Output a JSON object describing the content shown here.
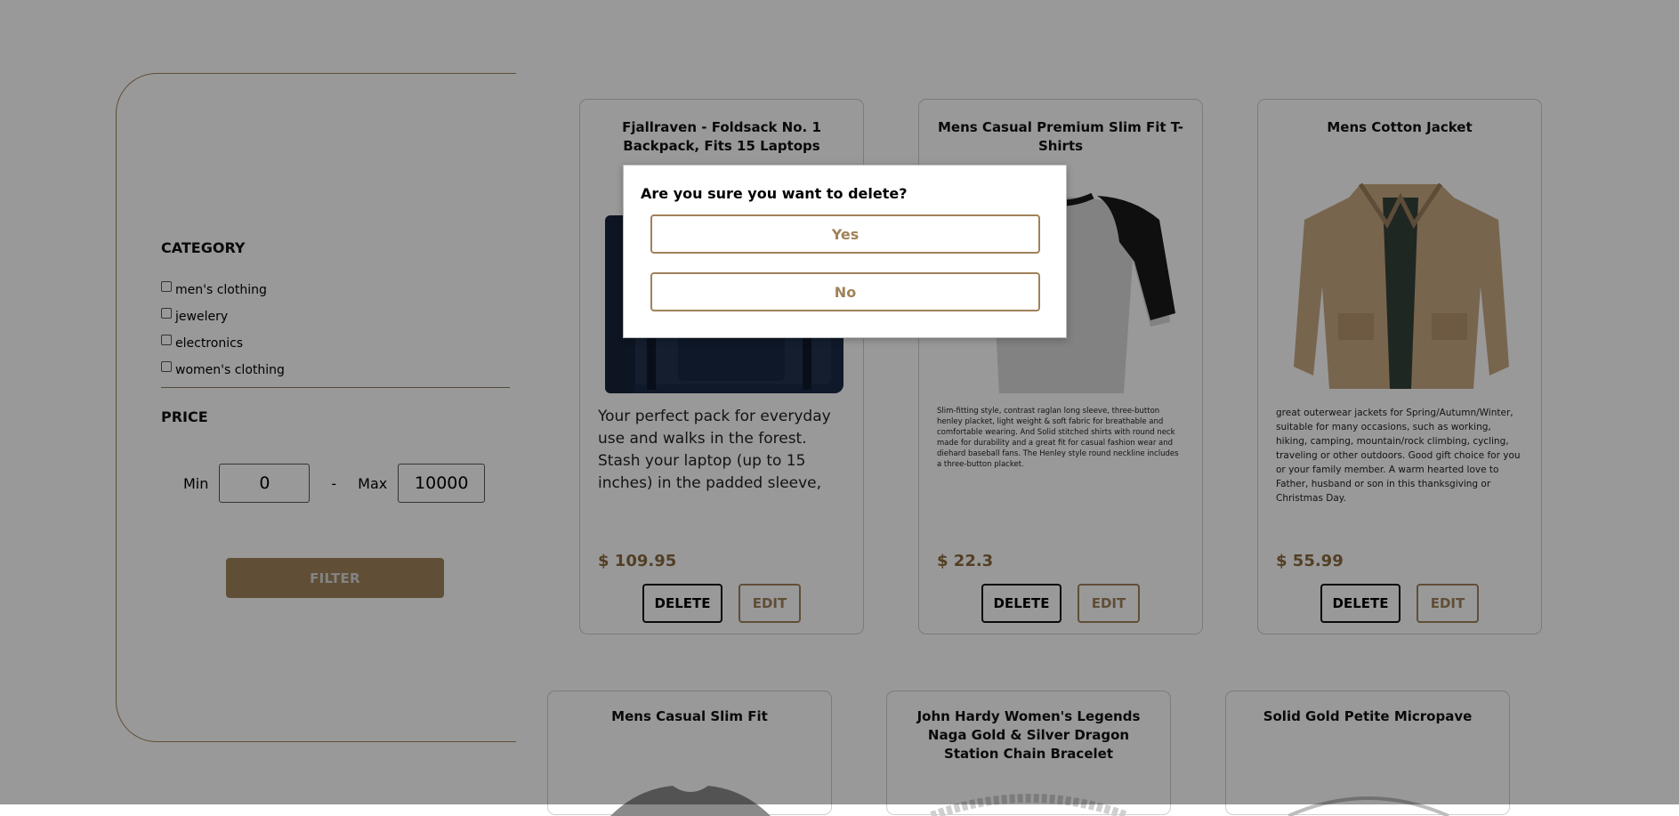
{
  "sidebar": {
    "category_heading": "CATEGORY",
    "categories": [
      "men's clothing",
      "jewelery",
      "electronics",
      "women's clothing"
    ],
    "price_heading": "PRICE",
    "min_label": "Min",
    "min_value": "0",
    "dash": "-",
    "max_label": "Max",
    "max_value": "10000",
    "filter_label": "FILTER"
  },
  "products": [
    {
      "title": "Fjallraven - Foldsack No. 1 Backpack, Fits 15 Laptops",
      "description": "Your perfect pack for everyday use and walks in the forest. Stash your laptop (up to 15 inches) in the padded sleeve, your everyday",
      "price": "$ 109.95",
      "delete_label": "DELETE",
      "edit_label": "EDIT"
    },
    {
      "title": "Mens Casual Premium Slim Fit T-Shirts",
      "description": "Slim-fitting style, contrast raglan long sleeve, three-button henley placket, light weight & soft fabric for breathable and comfortable wearing. And Solid stitched shirts with round neck made for durability and a great fit for casual fashion wear and diehard baseball fans. The Henley style round neckline includes a three-button placket.",
      "price": "$ 22.3",
      "delete_label": "DELETE",
      "edit_label": "EDIT"
    },
    {
      "title": "Mens Cotton Jacket",
      "description": "great outerwear jackets for Spring/Autumn/Winter, suitable for many occasions, such as working, hiking, camping, mountain/rock climbing, cycling, traveling or other outdoors. Good gift choice for you or your family member. A warm hearted love to Father, husband or son in this thanksgiving or Christmas Day.",
      "price": "$ 55.99",
      "delete_label": "DELETE",
      "edit_label": "EDIT"
    }
  ],
  "second_row": [
    {
      "title": "Mens Casual Slim Fit"
    },
    {
      "title": "John Hardy Women's Legends Naga Gold & Silver Dragon Station Chain Bracelet"
    },
    {
      "title": "Solid Gold Petite Micropave"
    }
  ],
  "modal": {
    "question": "Are you sure you want to delete?",
    "yes_label": "Yes",
    "no_label": "No"
  },
  "colors": {
    "accent": "#a0825a",
    "price": "#8a6a3e",
    "overlay": "rgba(0,0,0,0.4)"
  },
  "icons": {
    "product_1": "backpack-image",
    "product_2": "raglan-tshirt-image",
    "product_3": "cotton-jacket-image",
    "second_row_1": "tshirt-image",
    "second_row_2": "bracelet-image",
    "second_row_3": "ring-image"
  }
}
